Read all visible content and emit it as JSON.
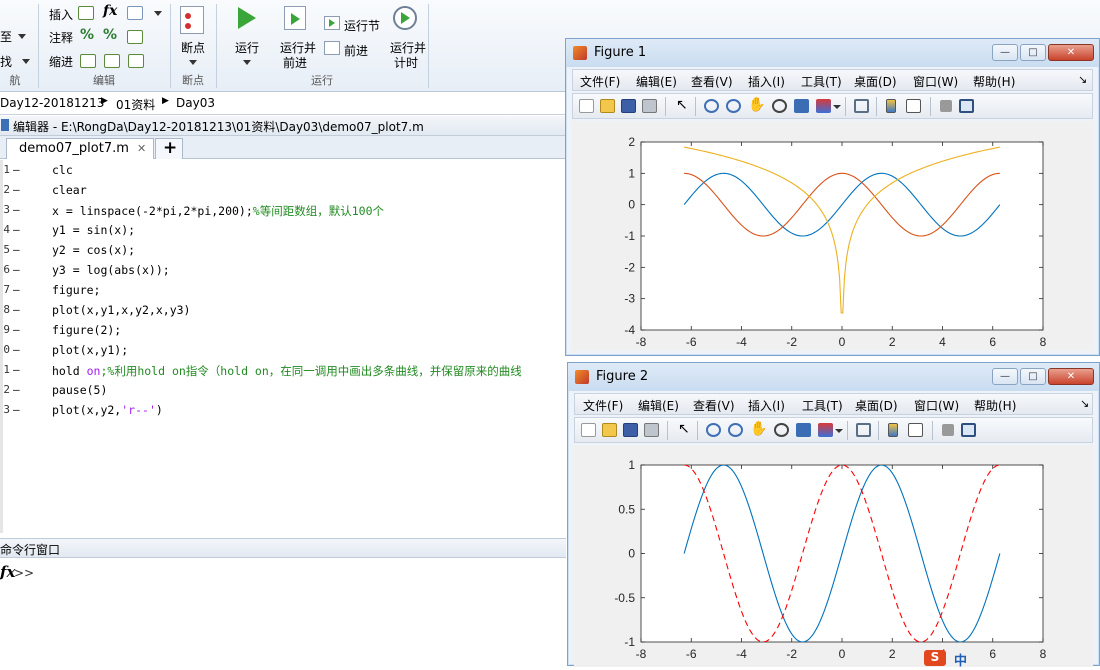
{
  "ribbon": {
    "left_partial": [
      "至",
      "找"
    ],
    "left_partial_group": "航",
    "edit_items": [
      "插入",
      "注释",
      "缩进"
    ],
    "edit_fx": "fx",
    "edit_group": "编辑",
    "breakpoint_label": "断点",
    "breakpoint_group": "断点",
    "run_label": "运行",
    "run_advance_label": [
      "运行并",
      "前进"
    ],
    "run_section_label": "运行节",
    "advance_label": "前进",
    "run_time_label": [
      "运行并",
      "计时"
    ],
    "run_group": "运行"
  },
  "breadcrumb": [
    "Day12-20181213",
    "01资料",
    "Day03"
  ],
  "editor": {
    "title": "编辑器 - E:\\RongDa\\Day12-20181213\\01资料\\Day03\\demo07_plot7.m",
    "tab_label": "demo07_plot7.m",
    "close_glyph": "✕",
    "add_glyph": "+",
    "line_numbers": [
      "1",
      "2",
      "3",
      "4",
      "5",
      "6",
      "7",
      "8",
      "9",
      "0",
      "1",
      "2",
      "3"
    ],
    "line_dash": "–",
    "lines": [
      {
        "code": "clc",
        "comment": "",
        "str": ""
      },
      {
        "code": "clear",
        "comment": "",
        "str": ""
      },
      {
        "code": "x = linspace(-2*pi,2*pi,200);",
        "comment": "%等间距数组，默认100个",
        "str": ""
      },
      {
        "code": "y1 = sin(x);",
        "comment": "",
        "str": ""
      },
      {
        "code": "y2 = cos(x);",
        "comment": "",
        "str": ""
      },
      {
        "code": "y3 = log(abs(x));",
        "comment": "",
        "str": ""
      },
      {
        "code": "figure;",
        "comment": "",
        "str": ""
      },
      {
        "code": "plot(x,y1,x,y2,x,y3)",
        "comment": "",
        "str": ""
      },
      {
        "code": "figure(2);",
        "comment": "",
        "str": ""
      },
      {
        "code": "plot(x,y1);",
        "comment": "",
        "str": ""
      },
      {
        "code": "hold ",
        "str": "on",
        "comment": ";%利用hold on指令（hold on，在同一调用中画出多条曲线，并保留原来的曲线"
      },
      {
        "code": "pause(5)",
        "comment": "",
        "str": ""
      },
      {
        "code": "plot(x,y2,",
        "str": "'r--'",
        "comment": "",
        "tail": ")"
      }
    ]
  },
  "command_window": {
    "title": "命令行窗口",
    "fx": "fx",
    "prompt": ">>"
  },
  "figure1": {
    "title": "Figure 1",
    "win_buttons": [
      "—",
      "□",
      "✕"
    ],
    "menu": [
      "文件(F)",
      "编辑(E)",
      "查看(V)",
      "插入(I)",
      "工具(T)",
      "桌面(D)",
      "窗口(W)",
      "帮助(H)"
    ],
    "menu_arrow": "↘",
    "chart_data": {
      "type": "line",
      "xlim": [
        -8,
        8
      ],
      "ylim": [
        -4,
        2
      ],
      "xticks": [
        "-8",
        "-6",
        "-4",
        "-2",
        "0",
        "2",
        "4",
        "6",
        "8"
      ],
      "yticks": [
        "2",
        "1",
        "0",
        "-1",
        "-2",
        "-3",
        "-4"
      ],
      "series": [
        {
          "expr": "sin(x)",
          "color": "#0072bd",
          "style": "solid"
        },
        {
          "expr": "cos(x)",
          "color": "#d95319",
          "style": "solid"
        },
        {
          "expr": "log(abs(x))",
          "color": "#edb120",
          "style": "solid"
        }
      ],
      "x_range": [
        -6.2832,
        6.2832
      ],
      "samples": 200
    }
  },
  "figure2": {
    "title": "Figure 2",
    "win_buttons": [
      "—",
      "□",
      "✕"
    ],
    "menu": [
      "文件(F)",
      "编辑(E)",
      "查看(V)",
      "插入(I)",
      "工具(T)",
      "桌面(D)",
      "窗口(W)",
      "帮助(H)"
    ],
    "menu_arrow": "↘",
    "chart_data": {
      "type": "line",
      "xlim": [
        -8,
        8
      ],
      "ylim": [
        -1,
        1
      ],
      "xticks": [
        "-8",
        "-6",
        "-4",
        "-2",
        "0",
        "2",
        "4",
        "6",
        "8"
      ],
      "yticks": [
        "1",
        "0.5",
        "0",
        "-0.5",
        "-1"
      ],
      "series": [
        {
          "expr": "sin(x)",
          "color": "#0072bd",
          "style": "solid"
        },
        {
          "expr": "cos(x)",
          "color": "#ff0000",
          "style": "dashed"
        }
      ],
      "x_range": [
        -6.2832,
        6.2832
      ],
      "samples": 200
    }
  },
  "ime_bar": {
    "logo": "S",
    "text": "中"
  }
}
